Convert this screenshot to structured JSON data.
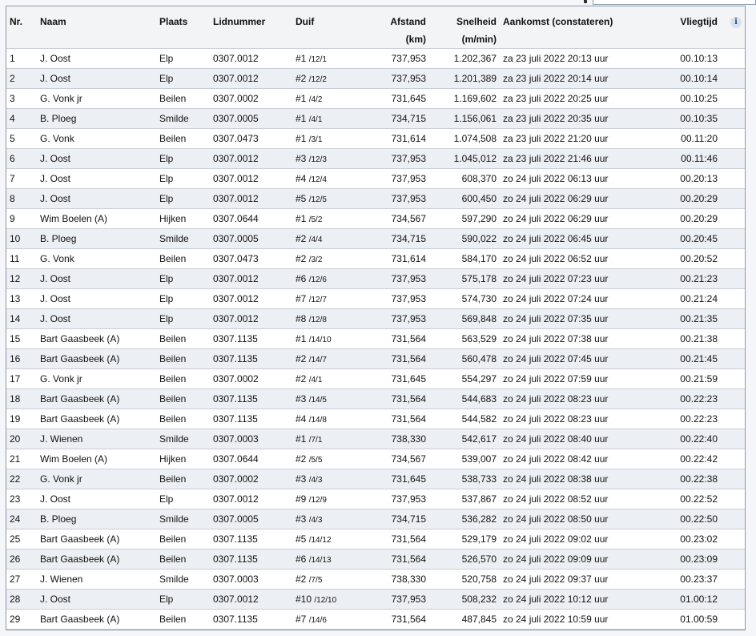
{
  "columns": {
    "nr": "Nr.",
    "naam": "Naam",
    "plaats": "Plaats",
    "lidnummer": "Lidnummer",
    "duif": "Duif",
    "afstand": "Afstand",
    "afstand_unit": "(km)",
    "snelheid": "Snelheid",
    "snelheid_unit": "(m/min)",
    "aankomst": "Aankomst (constateren)",
    "vliegtijd": "Vliegtijd",
    "info_icon_glyph": "i"
  },
  "rows": [
    {
      "nr": "1",
      "naam": "J. Oost",
      "plaats": "Elp",
      "lid": "0307.0012",
      "duif": "#1",
      "duif_sub": "/12/1",
      "afstand": "737,953",
      "snelheid": "1.202,367",
      "aankomst": "za 23 juli 2022 20:13 uur",
      "vliegtijd": "00.10:13"
    },
    {
      "nr": "2",
      "naam": "J. Oost",
      "plaats": "Elp",
      "lid": "0307.0012",
      "duif": "#2",
      "duif_sub": "/12/2",
      "afstand": "737,953",
      "snelheid": "1.201,389",
      "aankomst": "za 23 juli 2022 20:14 uur",
      "vliegtijd": "00.10:14"
    },
    {
      "nr": "3",
      "naam": "G. Vonk jr",
      "plaats": "Beilen",
      "lid": "0307.0002",
      "duif": "#1",
      "duif_sub": "/4/2",
      "afstand": "731,645",
      "snelheid": "1.169,602",
      "aankomst": "za 23 juli 2022 20:25 uur",
      "vliegtijd": "00.10:25"
    },
    {
      "nr": "4",
      "naam": "B. Ploeg",
      "plaats": "Smilde",
      "lid": "0307.0005",
      "duif": "#1",
      "duif_sub": "/4/1",
      "afstand": "734,715",
      "snelheid": "1.156,061",
      "aankomst": "za 23 juli 2022 20:35 uur",
      "vliegtijd": "00.10:35"
    },
    {
      "nr": "5",
      "naam": "G. Vonk",
      "plaats": "Beilen",
      "lid": "0307.0473",
      "duif": "#1",
      "duif_sub": "/3/1",
      "afstand": "731,614",
      "snelheid": "1.074,508",
      "aankomst": "za 23 juli 2022 21:20 uur",
      "vliegtijd": "00.11:20"
    },
    {
      "nr": "6",
      "naam": "J. Oost",
      "plaats": "Elp",
      "lid": "0307.0012",
      "duif": "#3",
      "duif_sub": "/12/3",
      "afstand": "737,953",
      "snelheid": "1.045,012",
      "aankomst": "za 23 juli 2022 21:46 uur",
      "vliegtijd": "00.11:46"
    },
    {
      "nr": "7",
      "naam": "J. Oost",
      "plaats": "Elp",
      "lid": "0307.0012",
      "duif": "#4",
      "duif_sub": "/12/4",
      "afstand": "737,953",
      "snelheid": "608,370",
      "aankomst": "zo 24 juli 2022 06:13 uur",
      "vliegtijd": "00.20:13"
    },
    {
      "nr": "8",
      "naam": "J. Oost",
      "plaats": "Elp",
      "lid": "0307.0012",
      "duif": "#5",
      "duif_sub": "/12/5",
      "afstand": "737,953",
      "snelheid": "600,450",
      "aankomst": "zo 24 juli 2022 06:29 uur",
      "vliegtijd": "00.20:29"
    },
    {
      "nr": "9",
      "naam": "Wim Boelen (A)",
      "plaats": "Hijken",
      "lid": "0307.0644",
      "duif": "#1",
      "duif_sub": "/5/2",
      "afstand": "734,567",
      "snelheid": "597,290",
      "aankomst": "zo 24 juli 2022 06:29 uur",
      "vliegtijd": "00.20:29"
    },
    {
      "nr": "10",
      "naam": "B. Ploeg",
      "plaats": "Smilde",
      "lid": "0307.0005",
      "duif": "#2",
      "duif_sub": "/4/4",
      "afstand": "734,715",
      "snelheid": "590,022",
      "aankomst": "zo 24 juli 2022 06:45 uur",
      "vliegtijd": "00.20:45"
    },
    {
      "nr": "11",
      "naam": "G. Vonk",
      "plaats": "Beilen",
      "lid": "0307.0473",
      "duif": "#2",
      "duif_sub": "/3/2",
      "afstand": "731,614",
      "snelheid": "584,170",
      "aankomst": "zo 24 juli 2022 06:52 uur",
      "vliegtijd": "00.20:52"
    },
    {
      "nr": "12",
      "naam": "J. Oost",
      "plaats": "Elp",
      "lid": "0307.0012",
      "duif": "#6",
      "duif_sub": "/12/6",
      "afstand": "737,953",
      "snelheid": "575,178",
      "aankomst": "zo 24 juli 2022 07:23 uur",
      "vliegtijd": "00.21:23"
    },
    {
      "nr": "13",
      "naam": "J. Oost",
      "plaats": "Elp",
      "lid": "0307.0012",
      "duif": "#7",
      "duif_sub": "/12/7",
      "afstand": "737,953",
      "snelheid": "574,730",
      "aankomst": "zo 24 juli 2022 07:24 uur",
      "vliegtijd": "00.21:24"
    },
    {
      "nr": "14",
      "naam": "J. Oost",
      "plaats": "Elp",
      "lid": "0307.0012",
      "duif": "#8",
      "duif_sub": "/12/8",
      "afstand": "737,953",
      "snelheid": "569,848",
      "aankomst": "zo 24 juli 2022 07:35 uur",
      "vliegtijd": "00.21:35"
    },
    {
      "nr": "15",
      "naam": "Bart Gaasbeek (A)",
      "plaats": "Beilen",
      "lid": "0307.1135",
      "duif": "#1",
      "duif_sub": "/14/10",
      "afstand": "731,564",
      "snelheid": "563,529",
      "aankomst": "zo 24 juli 2022 07:38 uur",
      "vliegtijd": "00.21:38"
    },
    {
      "nr": "16",
      "naam": "Bart Gaasbeek (A)",
      "plaats": "Beilen",
      "lid": "0307.1135",
      "duif": "#2",
      "duif_sub": "/14/7",
      "afstand": "731,564",
      "snelheid": "560,478",
      "aankomst": "zo 24 juli 2022 07:45 uur",
      "vliegtijd": "00.21:45"
    },
    {
      "nr": "17",
      "naam": "G. Vonk jr",
      "plaats": "Beilen",
      "lid": "0307.0002",
      "duif": "#2",
      "duif_sub": "/4/1",
      "afstand": "731,645",
      "snelheid": "554,297",
      "aankomst": "zo 24 juli 2022 07:59 uur",
      "vliegtijd": "00.21:59"
    },
    {
      "nr": "18",
      "naam": "Bart Gaasbeek (A)",
      "plaats": "Beilen",
      "lid": "0307.1135",
      "duif": "#3",
      "duif_sub": "/14/5",
      "afstand": "731,564",
      "snelheid": "544,683",
      "aankomst": "zo 24 juli 2022 08:23 uur",
      "vliegtijd": "00.22:23"
    },
    {
      "nr": "19",
      "naam": "Bart Gaasbeek (A)",
      "plaats": "Beilen",
      "lid": "0307.1135",
      "duif": "#4",
      "duif_sub": "/14/8",
      "afstand": "731,564",
      "snelheid": "544,582",
      "aankomst": "zo 24 juli 2022 08:23 uur",
      "vliegtijd": "00.22:23"
    },
    {
      "nr": "20",
      "naam": "J. Wienen",
      "plaats": "Smilde",
      "lid": "0307.0003",
      "duif": "#1",
      "duif_sub": "/7/1",
      "afstand": "738,330",
      "snelheid": "542,617",
      "aankomst": "zo 24 juli 2022 08:40 uur",
      "vliegtijd": "00.22:40"
    },
    {
      "nr": "21",
      "naam": "Wim Boelen (A)",
      "plaats": "Hijken",
      "lid": "0307.0644",
      "duif": "#2",
      "duif_sub": "/5/5",
      "afstand": "734,567",
      "snelheid": "539,007",
      "aankomst": "zo 24 juli 2022 08:42 uur",
      "vliegtijd": "00.22:42"
    },
    {
      "nr": "22",
      "naam": "G. Vonk jr",
      "plaats": "Beilen",
      "lid": "0307.0002",
      "duif": "#3",
      "duif_sub": "/4/3",
      "afstand": "731,645",
      "snelheid": "538,733",
      "aankomst": "zo 24 juli 2022 08:38 uur",
      "vliegtijd": "00.22:38"
    },
    {
      "nr": "23",
      "naam": "J. Oost",
      "plaats": "Elp",
      "lid": "0307.0012",
      "duif": "#9",
      "duif_sub": "/12/9",
      "afstand": "737,953",
      "snelheid": "537,867",
      "aankomst": "zo 24 juli 2022 08:52 uur",
      "vliegtijd": "00.22:52"
    },
    {
      "nr": "24",
      "naam": "B. Ploeg",
      "plaats": "Smilde",
      "lid": "0307.0005",
      "duif": "#3",
      "duif_sub": "/4/3",
      "afstand": "734,715",
      "snelheid": "536,282",
      "aankomst": "zo 24 juli 2022 08:50 uur",
      "vliegtijd": "00.22:50"
    },
    {
      "nr": "25",
      "naam": "Bart Gaasbeek (A)",
      "plaats": "Beilen",
      "lid": "0307.1135",
      "duif": "#5",
      "duif_sub": "/14/12",
      "afstand": "731,564",
      "snelheid": "529,179",
      "aankomst": "zo 24 juli 2022 09:02 uur",
      "vliegtijd": "00.23:02"
    },
    {
      "nr": "26",
      "naam": "Bart Gaasbeek (A)",
      "plaats": "Beilen",
      "lid": "0307.1135",
      "duif": "#6",
      "duif_sub": "/14/13",
      "afstand": "731,564",
      "snelheid": "526,570",
      "aankomst": "zo 24 juli 2022 09:09 uur",
      "vliegtijd": "00.23:09"
    },
    {
      "nr": "27",
      "naam": "J. Wienen",
      "plaats": "Smilde",
      "lid": "0307.0003",
      "duif": "#2",
      "duif_sub": "/7/5",
      "afstand": "738,330",
      "snelheid": "520,758",
      "aankomst": "zo 24 juli 2022 09:37 uur",
      "vliegtijd": "00.23:37"
    },
    {
      "nr": "28",
      "naam": "J. Oost",
      "plaats": "Elp",
      "lid": "0307.0012",
      "duif": "#10",
      "duif_sub": "/12/10",
      "afstand": "737,953",
      "snelheid": "508,232",
      "aankomst": "zo 24 juli 2022 10:12 uur",
      "vliegtijd": "01.00:12"
    },
    {
      "nr": "29",
      "naam": "Bart Gaasbeek (A)",
      "plaats": "Beilen",
      "lid": "0307.1135",
      "duif": "#7",
      "duif_sub": "/14/6",
      "afstand": "731,564",
      "snelheid": "487,845",
      "aankomst": "zo 24 juli 2022 10:59 uur",
      "vliegtijd": "01.00:59"
    }
  ]
}
